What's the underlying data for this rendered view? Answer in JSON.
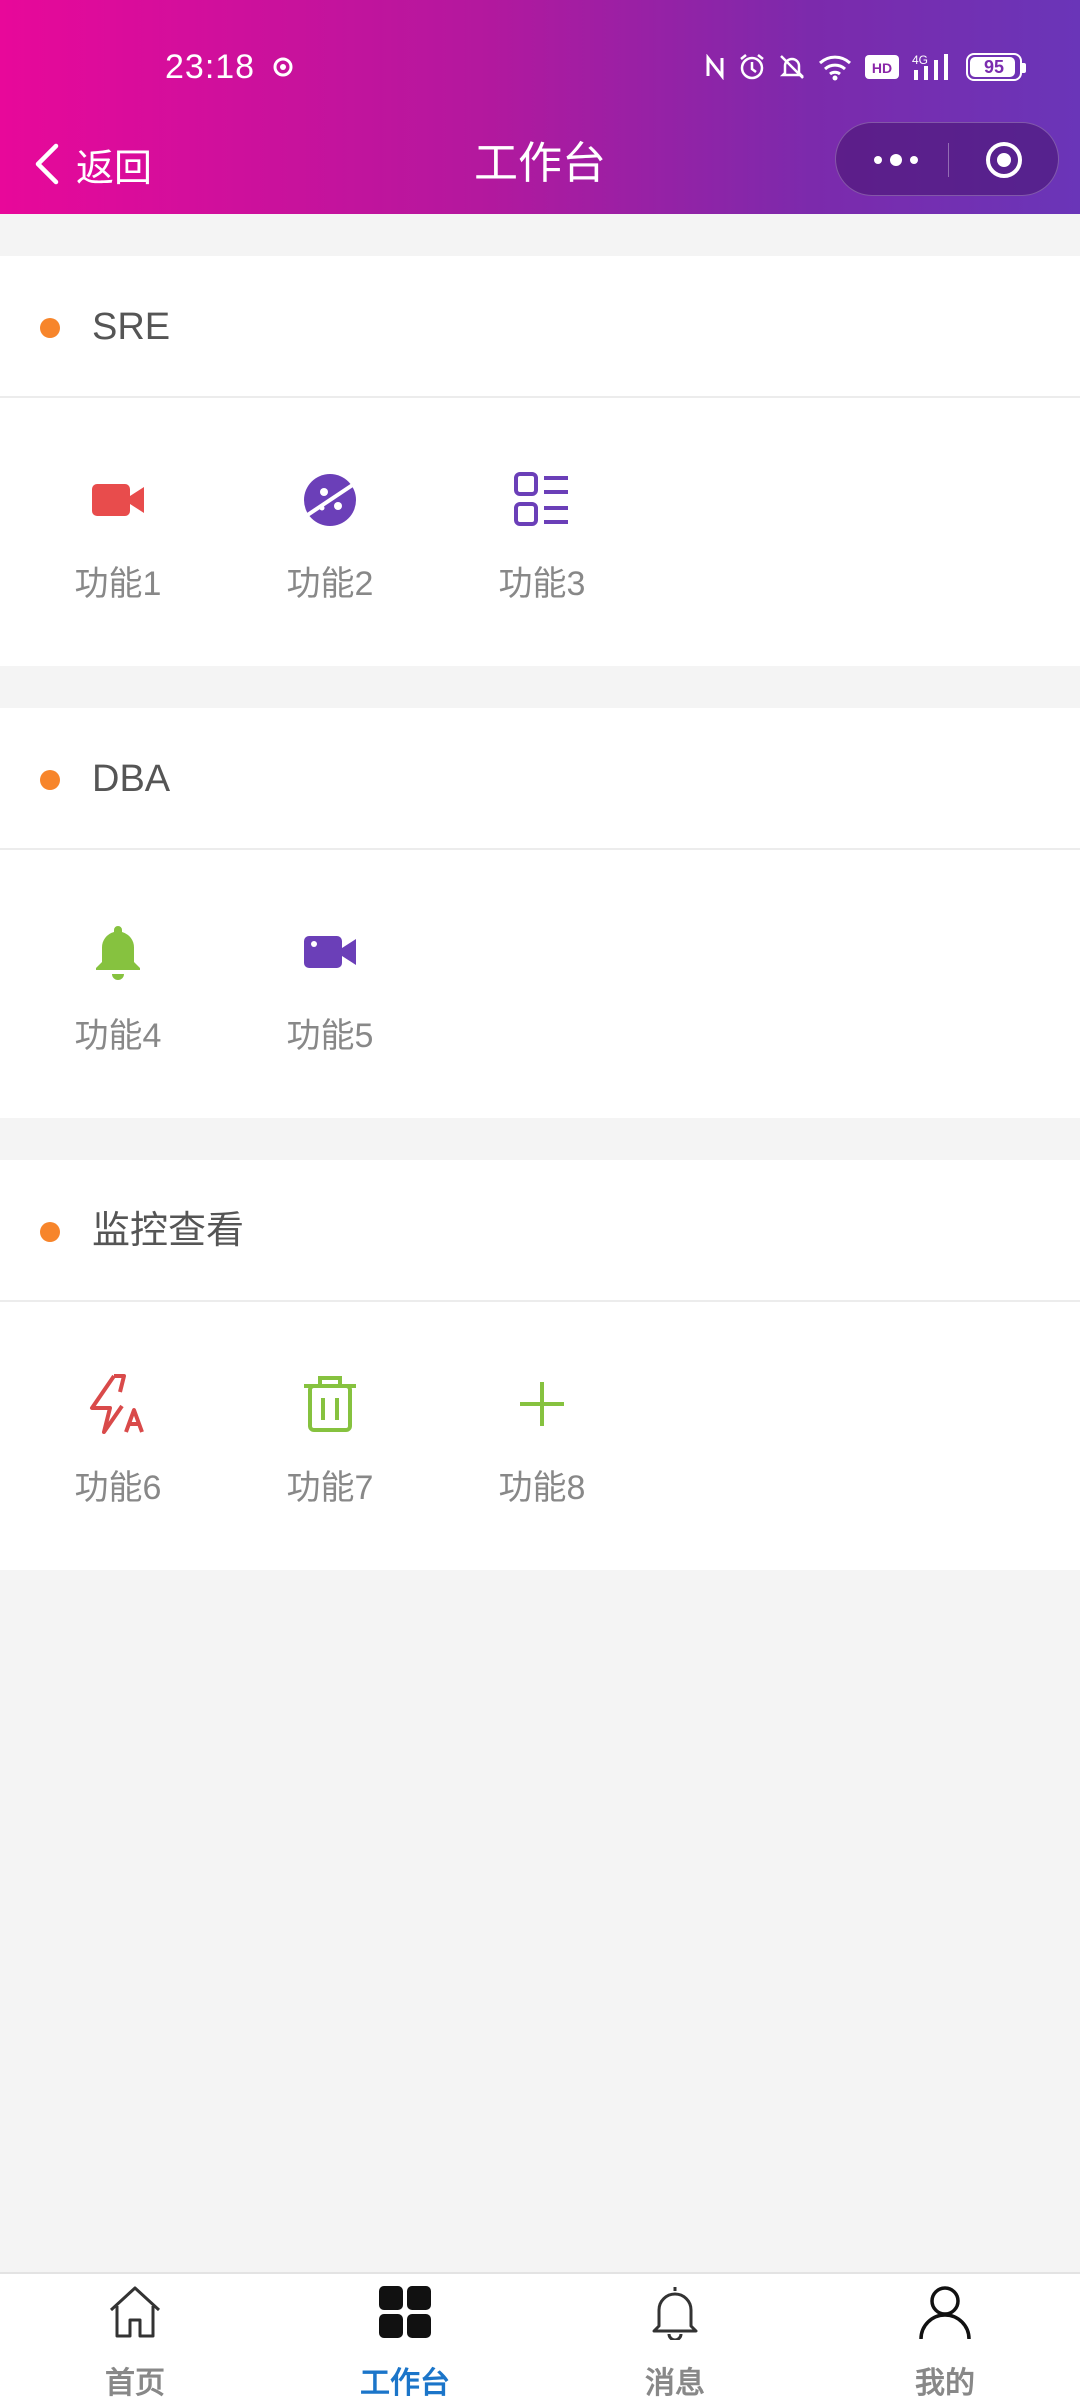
{
  "status_bar": {
    "time": "23:18",
    "network": "4G",
    "hd_label": "HD",
    "battery": 95
  },
  "nav": {
    "back_label": "返回",
    "title": "工作台"
  },
  "sections": [
    {
      "title": "SRE",
      "items": [
        {
          "label": "功能1",
          "icon": "video-camera-icon",
          "color": "#e84c4c"
        },
        {
          "label": "功能2",
          "icon": "planet-icon",
          "color": "#6b3fb8"
        },
        {
          "label": "功能3",
          "icon": "list-icon",
          "color": "#6b3fb8"
        }
      ]
    },
    {
      "title": "DBA",
      "items": [
        {
          "label": "功能4",
          "icon": "bell-icon",
          "color": "#86c23f"
        },
        {
          "label": "功能5",
          "icon": "video-camera-icon",
          "color": "#6b3fb8"
        }
      ]
    },
    {
      "title": "监控查看",
      "items": [
        {
          "label": "功能6",
          "icon": "flash-auto-icon",
          "color": "#d94a4a"
        },
        {
          "label": "功能7",
          "icon": "trash-icon",
          "color": "#86c23f"
        },
        {
          "label": "功能8",
          "icon": "plus-icon",
          "color": "#86c23f"
        }
      ]
    }
  ],
  "tab_bar": {
    "tabs": [
      {
        "label": "首页",
        "icon": "home-icon",
        "active": false
      },
      {
        "label": "工作台",
        "icon": "grid-icon",
        "active": true
      },
      {
        "label": "消息",
        "icon": "bell-icon",
        "active": false
      },
      {
        "label": "我的",
        "icon": "user-icon",
        "active": false
      }
    ],
    "active_color": "#1b75c9"
  },
  "colors": {
    "header_gradient_start": "#e8089a",
    "header_gradient_end": "#6a35b8",
    "section_dot": "#f7852b"
  }
}
